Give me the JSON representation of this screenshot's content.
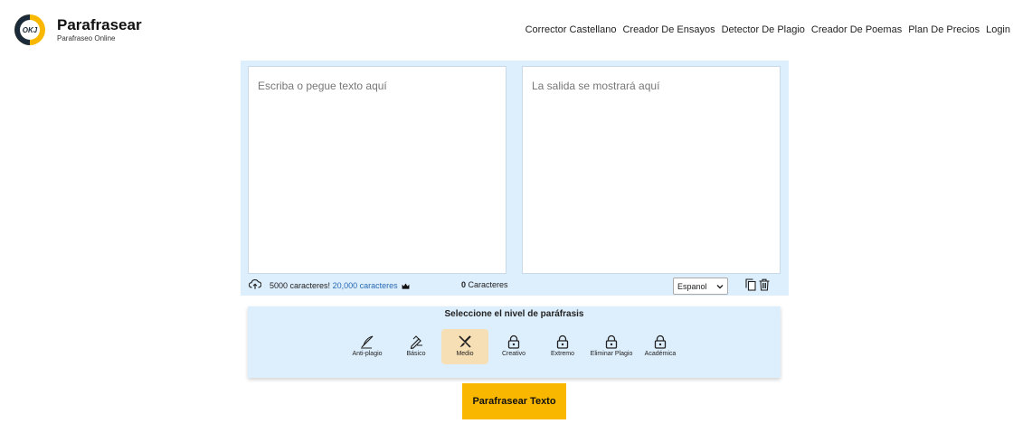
{
  "brand": {
    "title": "Parafrasear",
    "subtitle": "Parafraseo Online",
    "logo_text": "OKJ"
  },
  "nav": [
    "Corrector Castellano",
    "Creador De Ensayos",
    "Detector De Plagio",
    "Creador De Poemas",
    "Plan De Precios",
    "Login"
  ],
  "editor": {
    "input_placeholder": "Escriba o pegue texto aquí",
    "output_placeholder": "La salida se mostrará aquí",
    "chars_free": "5000 caracteres!",
    "chars_premium": "20,000 caracteres",
    "char_count_value": "0",
    "char_count_label": "Caracteres",
    "language": "Espanol"
  },
  "levels": {
    "title": "Seleccione el nivel de paráfrasis",
    "items": [
      {
        "label": "Anti-plagio",
        "icon": "feather-icon",
        "active": false
      },
      {
        "label": "Básico",
        "icon": "pen-icon",
        "active": false
      },
      {
        "label": "Medio",
        "icon": "brush-icon",
        "active": true
      },
      {
        "label": "Creativo",
        "icon": "lock-icon",
        "active": false
      },
      {
        "label": "Extremo",
        "icon": "lock-icon",
        "active": false
      },
      {
        "label": "Eliminar Plagio",
        "icon": "lock-icon",
        "active": false
      },
      {
        "label": "Académica",
        "icon": "lock-icon",
        "active": false
      }
    ]
  },
  "action": {
    "label": "Parafrasear Texto"
  },
  "colors": {
    "accent": "#f9b700",
    "panel": "#ddeefc",
    "active_level": "#f7dfb5",
    "link": "#2a6bb5"
  }
}
